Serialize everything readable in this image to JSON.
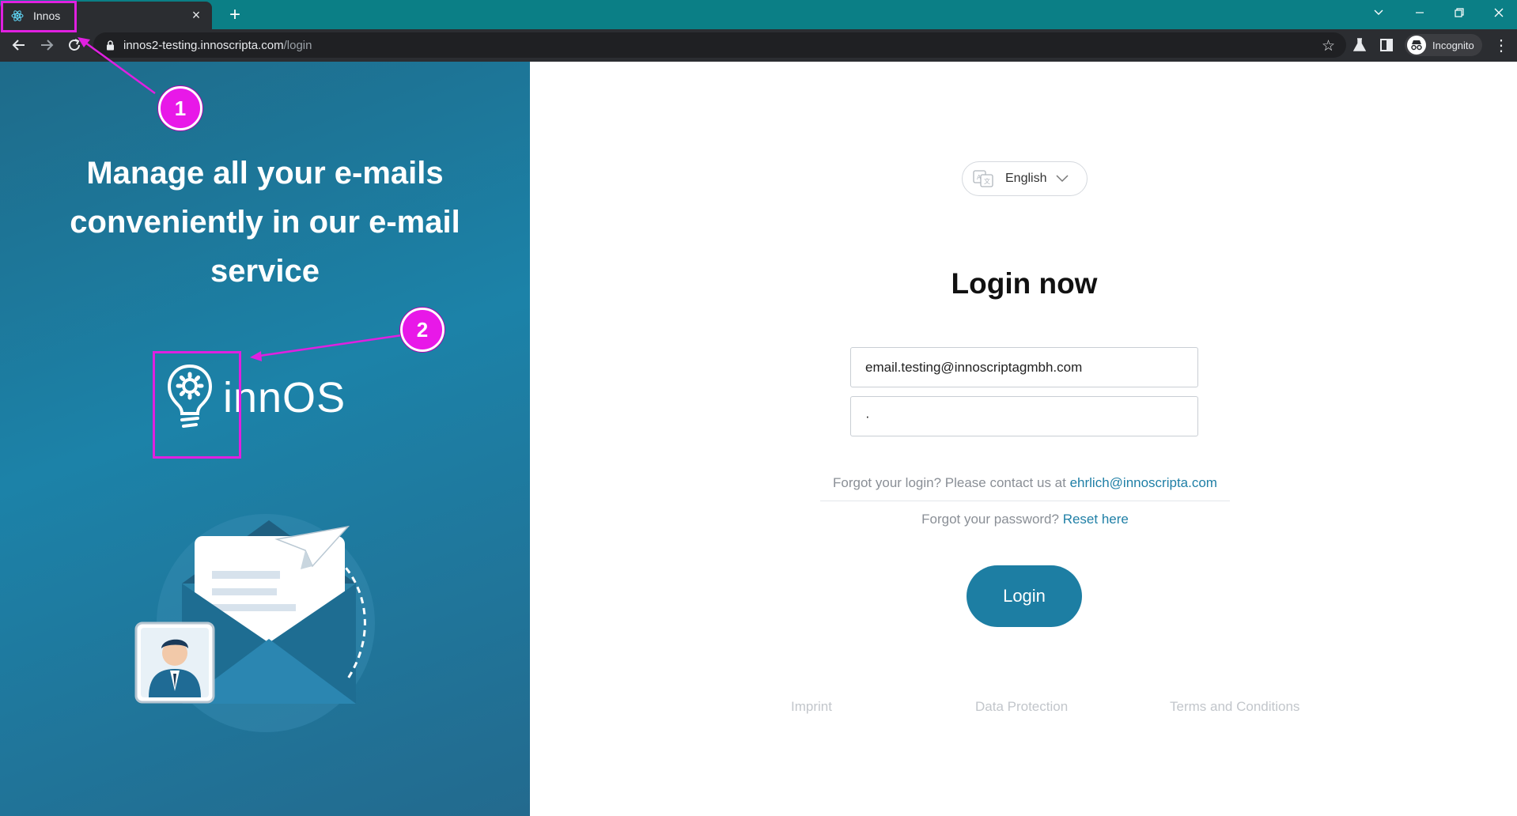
{
  "browser": {
    "tab_title": "Innos",
    "tab_close": "×",
    "new_tab": "+",
    "url_host": "innos2-testing.innoscripta.com",
    "url_path": "/login",
    "incognito_label": "Incognito"
  },
  "hero": {
    "headline": "Manage all your e-mails conveniently in our e-mail service",
    "logo_text": "innOS"
  },
  "language": {
    "selected": "English"
  },
  "login": {
    "title": "Login now",
    "email_value": "email.testing@innoscriptagmbh.com",
    "password_mask": "·",
    "forgot_login_text": "Forgot your login? Please contact us at ",
    "contact_email": "ehrlich@innoscripta.com",
    "forgot_password_text": "Forgot your password? ",
    "reset_link": "Reset here",
    "button_label": "Login"
  },
  "footer": {
    "imprint": "Imprint",
    "data_protection": "Data Protection",
    "terms": "Terms and Conditions"
  },
  "annotations": {
    "badge_1": "1",
    "badge_2": "2"
  },
  "colors": {
    "tabbar": "#0b7f86",
    "panel_gradient_start": "#1e6b8a",
    "accent": "#1d7ea3",
    "annotation": "#e818e8"
  }
}
